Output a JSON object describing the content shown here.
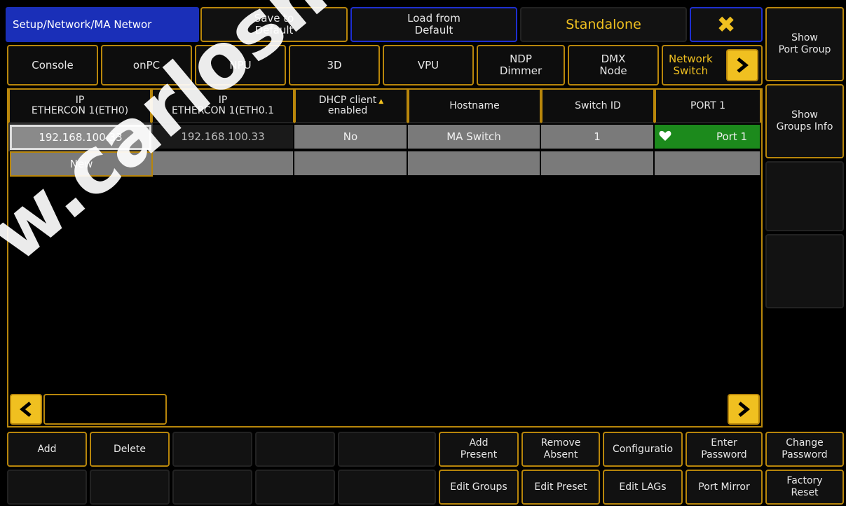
{
  "header": {
    "title": "Setup/Network/MA Networ",
    "save_default": "Save to\nDefault",
    "load_default": "Load from\nDefault",
    "mode": "Standalone",
    "close_icon": "close-x-icon"
  },
  "tabs": [
    {
      "label": "Console"
    },
    {
      "label": "onPC"
    },
    {
      "label": "NPU"
    },
    {
      "label": "3D"
    },
    {
      "label": "VPU"
    },
    {
      "label": "NDP\nDimmer"
    },
    {
      "label": "DMX\nNode"
    },
    {
      "label": "Network\nSwitch"
    }
  ],
  "table": {
    "columns": [
      "IP\nETHERCON 1(ETH0)",
      "IP\nETHERCON 1(ETH0.1",
      "DHCP client\nenabled",
      "Hostname",
      "Switch ID",
      "PORT 1"
    ],
    "rows": [
      {
        "ip1": "192.168.100.33",
        "ip2": "192.168.100.33",
        "dhcp": "No",
        "hostname": "MA Switch",
        "switch_id": "1",
        "port1": "Port 1"
      }
    ],
    "new_label": "New"
  },
  "sidebar": {
    "show_port_group": "Show\nPort Group",
    "show_groups_info": "Show\nGroups Info"
  },
  "bottom": {
    "add": "Add",
    "delete": "Delete",
    "add_present": "Add\nPresent",
    "remove_absent": "Remove\nAbsent",
    "configuration": "Configuratio",
    "enter_password": "Enter\nPassword",
    "change_password": "Change\nPassword",
    "edit_groups": "Edit Groups",
    "edit_preset": "Edit Preset",
    "edit_lags": "Edit LAGs",
    "port_mirror": "Port Mirror",
    "factory_reset": "Factory\nReset"
  },
  "watermark": "w.carlosmelo",
  "colors": {
    "accent": "#f0c020",
    "title_bg": "#1a2fb8",
    "port_green": "#1c8a1c"
  }
}
